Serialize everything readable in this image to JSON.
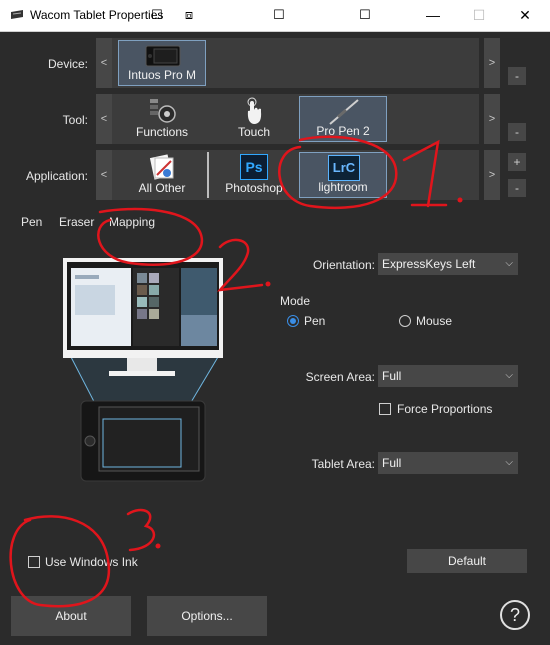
{
  "window": {
    "title": "Wacom Tablet Properties",
    "titlebar_icons": [
      "☐",
      "⧈",
      "☐",
      "☐"
    ],
    "controls": {
      "minimize": "—",
      "maximize": "☐",
      "close": "✕"
    }
  },
  "device_row": {
    "label": "Device:",
    "prev": "<",
    "next": ">",
    "tiles": [
      {
        "label": "Intuos Pro M",
        "selected": true
      }
    ],
    "remove": "-"
  },
  "tool_row": {
    "label": "Tool:",
    "prev": "<",
    "next": ">",
    "tiles": [
      {
        "label": "Functions",
        "selected": false
      },
      {
        "label": "Touch",
        "selected": false
      },
      {
        "label": "Pro Pen 2",
        "selected": true
      }
    ],
    "remove": "-"
  },
  "application_row": {
    "label": "Application:",
    "prev": "<",
    "next": ">",
    "tiles": [
      {
        "label": "All Other",
        "selected": false
      },
      {
        "label": "Photoshop",
        "icon_text": "Ps",
        "selected": false
      },
      {
        "label": "lightroom",
        "icon_text": "LrC",
        "selected": true
      }
    ],
    "add": "+",
    "remove": "-"
  },
  "tabs": [
    {
      "label": "Pen",
      "active": false
    },
    {
      "label": "Eraser",
      "active": false
    },
    {
      "label": "Mapping",
      "active": true
    }
  ],
  "mapping": {
    "orientation_label": "Orientation:",
    "orientation_value": "ExpressKeys Left",
    "mode_label": "Mode",
    "mode_pen": "Pen",
    "mode_mouse": "Mouse",
    "mode_selected": "Pen",
    "screen_area_label": "Screen Area:",
    "screen_area_value": "Full",
    "force_proportions": "Force Proportions",
    "force_proportions_checked": false,
    "tablet_area_label": "Tablet Area:",
    "tablet_area_value": "Full",
    "use_windows_ink": "Use Windows Ink",
    "use_windows_ink_checked": false,
    "default_button": "Default"
  },
  "footer": {
    "about": "About",
    "options": "Options...",
    "help": "?"
  },
  "annotations": [
    "1.",
    "2.",
    "3."
  ],
  "colors": {
    "background": "#2b2b2b",
    "strip": "#3c3c3c",
    "selected_tile": "#4a5563",
    "accent": "#3a8ee6",
    "annotation_red": "#e0151c"
  }
}
